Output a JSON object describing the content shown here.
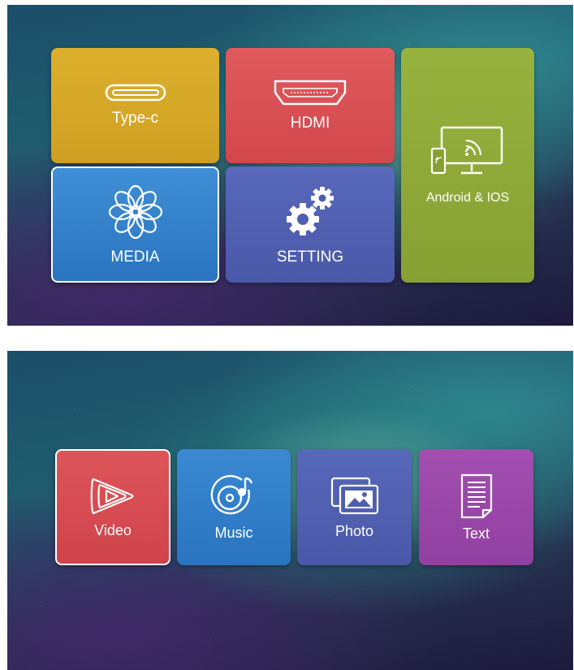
{
  "top_menu": {
    "tiles": [
      {
        "label": "Type-c",
        "icon": "usb-typec-icon",
        "color": "#d4a526"
      },
      {
        "label": "HDMI",
        "icon": "hdmi-icon",
        "color": "#d94f54"
      },
      {
        "label": "Android & IOS",
        "icon": "screen-mirroring-icon",
        "color": "#8fa93a"
      },
      {
        "label": "MEDIA",
        "icon": "flower-icon",
        "color": "#2f7dc7",
        "selected": true
      },
      {
        "label": "SETTING",
        "icon": "gears-icon",
        "color": "#4f5fb0"
      }
    ]
  },
  "media_menu": {
    "tiles": [
      {
        "label": "Video",
        "icon": "video-play-icon",
        "color": "#d64b52",
        "selected": true
      },
      {
        "label": "Music",
        "icon": "music-disc-icon",
        "color": "#2f7dc7"
      },
      {
        "label": "Photo",
        "icon": "photo-icon",
        "color": "#4f5fb0"
      },
      {
        "label": "Text",
        "icon": "document-icon",
        "color": "#9a47a8"
      }
    ]
  }
}
